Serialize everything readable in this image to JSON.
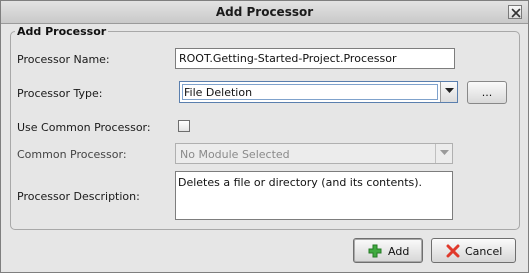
{
  "window": {
    "title": "Add Processor"
  },
  "group": {
    "title": "Add Processor"
  },
  "form": {
    "name_label": "Processor Name:",
    "name_value": "ROOT.Getting-Started-Project.Processor",
    "type_label": "Processor Type:",
    "type_value": "File Deletion",
    "type_browse_label": "...",
    "use_common_label": "Use Common Processor:",
    "use_common_checked": false,
    "common_label": "Common Processor:",
    "common_value": "No Module Selected",
    "description_label": "Processor Description:",
    "description_value": "Deletes a file or directory (and its contents)."
  },
  "buttons": {
    "add_label": "Add",
    "cancel_label": "Cancel"
  },
  "icons": {
    "close": "close-icon",
    "add": "plus-icon",
    "cancel": "x-icon",
    "dropdown": "chevron-down-icon"
  },
  "colors": {
    "add_icon": "#3faa3f",
    "cancel_icon": "#e0392b"
  }
}
